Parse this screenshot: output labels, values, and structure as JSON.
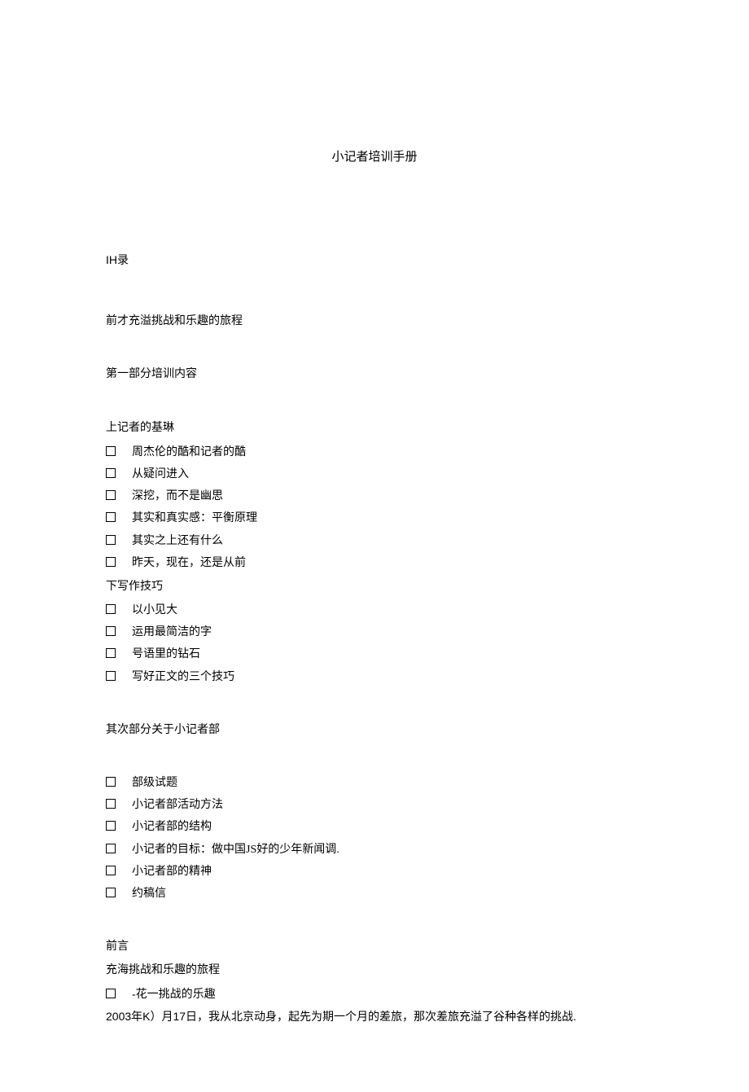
{
  "title": "小记者培训手册",
  "toc_label": "IH录",
  "preface_line": "前才充溢挑战和乐趣的旅程",
  "part1_heading": "第一部分培训内容",
  "section_a_heading": "上记者的基琳",
  "section_a_items": [
    "周杰伦的酷和记者的酷",
    "从疑问进入",
    "深挖，而不是幽思",
    "其实和真实感：平衡原理",
    "其实之上还有什么",
    "昨天，现在，还是从前"
  ],
  "section_b_heading": "下写作技巧",
  "section_b_items": [
    "以小见大",
    "运用最简洁的字",
    "号语里的钻石",
    "写好正文的三个技巧"
  ],
  "part2_heading": "其次部分关于小记者部",
  "part2_items": [
    "部级试题",
    "小记者部活动方法",
    "小记者部的结构",
    "小记者的目标：做中国JS好的少年新闻调.",
    "小记者部的精神",
    "约稿信"
  ],
  "foreword_heading": "前言",
  "foreword_sub": "充海挑战和乐趣的旅程",
  "foreword_bullet": "-花一挑战的乐趣",
  "foreword_body": "2003年K）月17日，我从北京动身，起先为期一个月的差旅，那次差旅充溢了谷种各样的挑战."
}
